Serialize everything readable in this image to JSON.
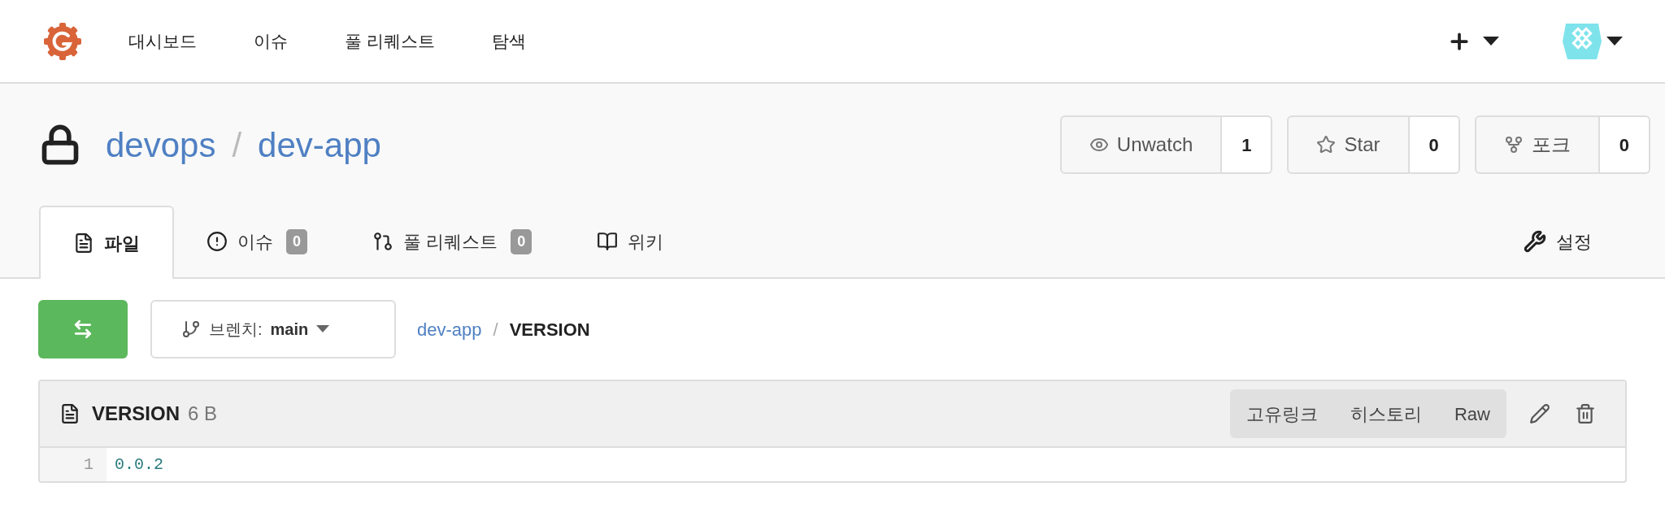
{
  "nav": {
    "items": [
      "대시보드",
      "이슈",
      "풀 리퀘스트",
      "탐색"
    ]
  },
  "repo": {
    "private": true,
    "owner": "devops",
    "separator": "/",
    "name": "dev-app"
  },
  "repo_buttons": [
    {
      "kind": "watch",
      "label": "Unwatch",
      "count": "1"
    },
    {
      "kind": "star",
      "label": "Star",
      "count": "0"
    },
    {
      "kind": "fork",
      "label": "포크",
      "count": "0"
    }
  ],
  "tabs": [
    {
      "kind": "files",
      "label": "파일",
      "selected": true
    },
    {
      "kind": "issues",
      "label": "이슈",
      "count": "0",
      "selected": false
    },
    {
      "kind": "pulls",
      "label": "풀 리퀘스트",
      "count": "0",
      "selected": false
    },
    {
      "kind": "wiki",
      "label": "위키",
      "selected": false
    }
  ],
  "settings_tab": {
    "label": "설정"
  },
  "branch": {
    "label": "브렌치:",
    "name": "main"
  },
  "breadcrumb": {
    "repo": "dev-app",
    "separator": "/",
    "file": "VERSION"
  },
  "file": {
    "name": "VERSION",
    "size": "6 B",
    "actions": [
      "고유링크",
      "히스토리",
      "Raw"
    ],
    "lines": [
      {
        "number": "1",
        "code": "0.0.2"
      }
    ]
  }
}
